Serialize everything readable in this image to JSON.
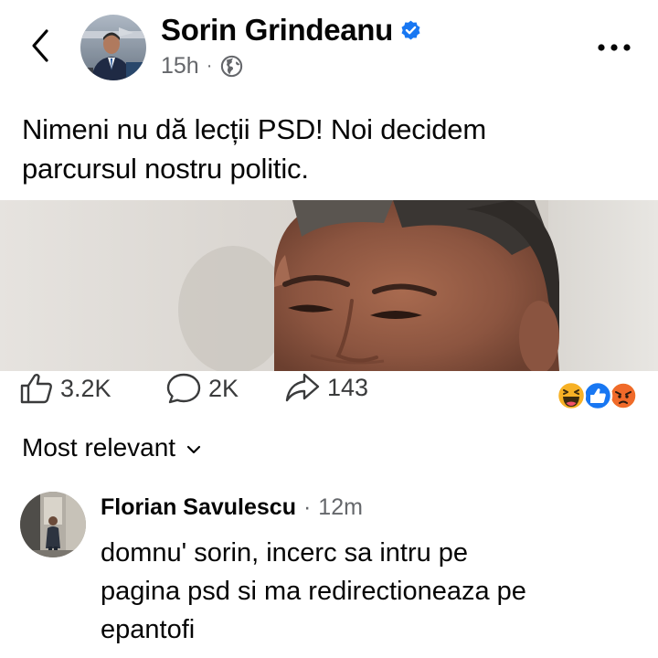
{
  "post": {
    "author": "Sorin Grindeanu",
    "time": "15h",
    "separator": "·",
    "text_line1": "Nimeni nu dă lecții PSD! Noi decidem",
    "text_line2": "parcursul nostru politic."
  },
  "stats": {
    "likes": "3.2K",
    "comments": "2K",
    "shares": "143"
  },
  "comments_section": {
    "sort_label": "Most relevant"
  },
  "comment": {
    "author": "Florian Savulescu",
    "separator": "·",
    "time": "12m",
    "text_line1": "domnu' sorin, incerc sa intru pe",
    "text_line2": "pagina psd si ma redirectioneaza pe",
    "text_line3": "epantofi"
  },
  "icons": {
    "back": "chevron-left-icon",
    "verified": "verified-badge-icon",
    "audience": "globe-icon",
    "more": "more-options-icon",
    "like": "thumbs-up-icon",
    "comment": "comment-bubble-icon",
    "share": "share-arrow-icon",
    "sort": "chevron-down-icon"
  },
  "colors": {
    "text": "#050505",
    "secondary": "#65676b",
    "verified": "#1877f2",
    "like": "#1877f2",
    "haha": "#f7b125",
    "angry": "#e9710f"
  }
}
